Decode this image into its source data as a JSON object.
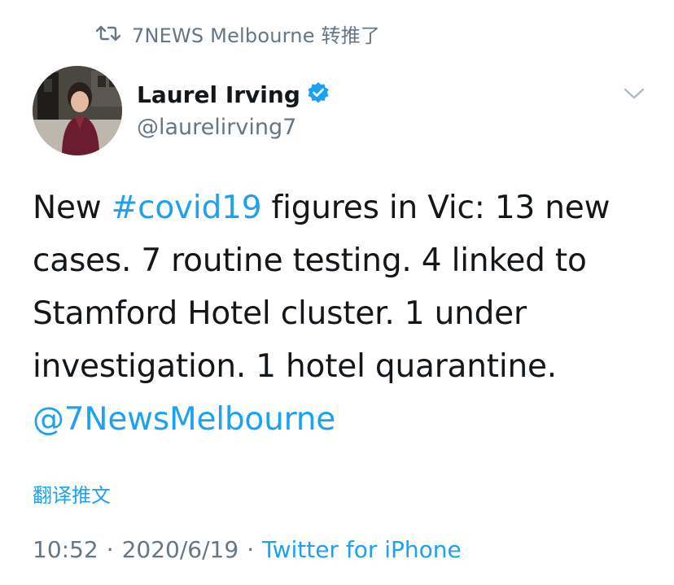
{
  "retweet": {
    "icon": "retweet-icon",
    "text": "7NEWS Melbourne 转推了"
  },
  "author": {
    "display_name": "Laurel Irving",
    "verified_icon": "verified-badge-icon",
    "handle": "@laurelirving7"
  },
  "menu": {
    "icon": "chevron-down-icon"
  },
  "tweet": {
    "lines": [
      {
        "pre": "New ",
        "hashtag": "#covid19",
        "post": " figures in Vic: 13 new"
      },
      {
        "text": "cases. 7 routine testing. 4 linked to"
      },
      {
        "text": "Stamford Hotel cluster. 1 under"
      },
      {
        "text": "investigation. 1 hotel quarantine."
      },
      {
        "mention": "@7NewsMelbourne"
      }
    ]
  },
  "translate_label": "翻译推文",
  "meta": {
    "time": "10:52",
    "separator": "·",
    "date": "2020/6/19",
    "source": "Twitter for iPhone"
  },
  "colors": {
    "accent": "#1da1f2",
    "secondary_text": "#657786",
    "primary_text": "#14171a"
  }
}
